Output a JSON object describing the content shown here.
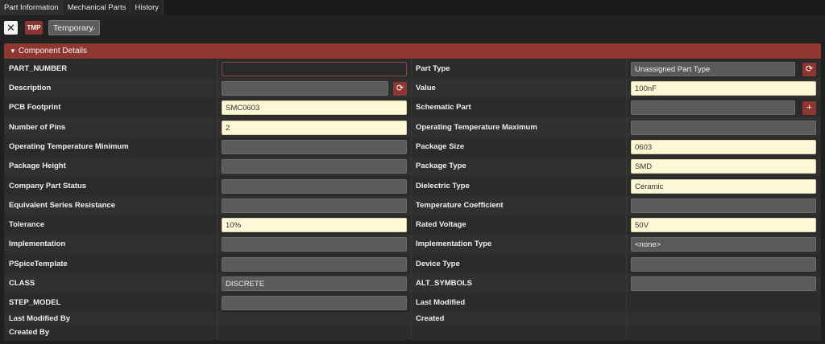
{
  "tabs": [
    "Part Information",
    "Mechanical Parts",
    "History"
  ],
  "toolbar": {
    "close_glyph": "✕",
    "badge": "TMP",
    "status_value": "Temporary"
  },
  "panel": {
    "title": "Component Details"
  },
  "rows": [
    {
      "left_label": "PART_NUMBER",
      "left_value": "",
      "right_label": "Part Type",
      "right_value": "Unassigned Part Type"
    },
    {
      "left_label": "Description",
      "left_value": "",
      "right_label": "Value",
      "right_value": "100nF"
    },
    {
      "left_label": "PCB Footprint",
      "left_value": "SMC0603",
      "right_label": "Schematic Part",
      "right_value": ""
    },
    {
      "left_label": "Number of Pins",
      "left_value": "2",
      "right_label": "Operating Temperature Maximum",
      "right_value": ""
    },
    {
      "left_label": "Operating Temperature Minimum",
      "left_value": "",
      "right_label": "Package Size",
      "right_value": "0603"
    },
    {
      "left_label": "Package Height",
      "left_value": "",
      "right_label": "Package Type",
      "right_value": "SMD"
    },
    {
      "left_label": "Company Part Status",
      "left_value": "",
      "right_label": "Dielectric Type",
      "right_value": "Ceramic"
    },
    {
      "left_label": "Equivalent Series Resistance",
      "left_value": "",
      "right_label": "Temperature Coefficient",
      "right_value": ""
    },
    {
      "left_label": "Tolerance",
      "left_value": "10%",
      "right_label": "Rated Voltage",
      "right_value": "50V"
    },
    {
      "left_label": "Implementation",
      "left_value": "",
      "right_label": "Implementation Type",
      "right_value": "<none>"
    },
    {
      "left_label": "PSpiceTemplate",
      "left_value": "",
      "right_label": "Device Type",
      "right_value": ""
    },
    {
      "left_label": "CLASS",
      "left_value": "DISCRETE",
      "right_label": "ALT_SYMBOLS",
      "right_value": ""
    },
    {
      "left_label": "STEP_MODEL",
      "left_value": "",
      "right_label": "Last Modified",
      "right_value": ""
    },
    {
      "left_label": "Last Modified By",
      "left_value": "",
      "right_label": "Created",
      "right_value": ""
    },
    {
      "left_label": "Created By",
      "left_value": "",
      "right_label": "",
      "right_value": ""
    }
  ],
  "icons": {
    "refresh": "refresh-icon",
    "add": "plus-icon",
    "close": "close-icon"
  }
}
